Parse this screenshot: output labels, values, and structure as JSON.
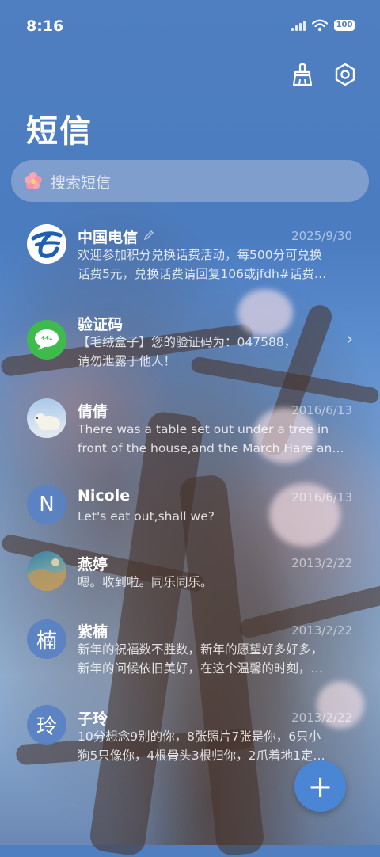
{
  "status_bar": {
    "time": "8:16",
    "battery": "100"
  },
  "header": {
    "title": "短信",
    "clean_icon": "broom-icon",
    "settings_icon": "settings-icon"
  },
  "search": {
    "placeholder": "搜索短信",
    "icon": "flower-icon"
  },
  "conversations": [
    {
      "name": "中国电信",
      "date": "2025/9/30",
      "line1": "欢迎参加积分兑换话费活动，每500分可兑换",
      "line2": "话费5元，兑换话费请回复106或jfdh#话费…",
      "avatar": "china-telecom-logo",
      "edit_icon": "pencil-icon"
    },
    {
      "name": "验证码",
      "date": "",
      "line1": "【毛绒盒子】您的验证码为：047588，",
      "line2": "请勿泄露于他人！",
      "avatar": "sms-code-icon"
    },
    {
      "name": "倩倩",
      "date": "2016/6/13",
      "line1": "There was a table set out under a tree in",
      "line2": "front of the house,and the March Hare an…",
      "avatar": "polar-bear-photo"
    },
    {
      "name": "Nicole",
      "date": "2016/6/13",
      "line1": "Let's eat out,shall we?",
      "line2": "",
      "avatar_letter": "N"
    },
    {
      "name": "燕婷",
      "date": "2013/2/22",
      "line1": "嗯。收到啦。同乐同乐。",
      "line2": "",
      "avatar": "landscape-photo"
    },
    {
      "name": "紫楠",
      "date": "2013/2/22",
      "line1": "新年的祝福数不胜数，新年的愿望好多好多，",
      "line2": "新年的问候依旧美好，在这个温馨的时刻，…",
      "avatar_letter": "楠"
    },
    {
      "name": "子玲",
      "date": "2013/2/22",
      "line1": "10分想念9别的你，8张照片7张是你，6只小",
      "line2": "狗5只像你，4根骨头3根归你，2爪着地1定…",
      "avatar_letter": "玲"
    }
  ],
  "fab": {
    "label": "+"
  }
}
